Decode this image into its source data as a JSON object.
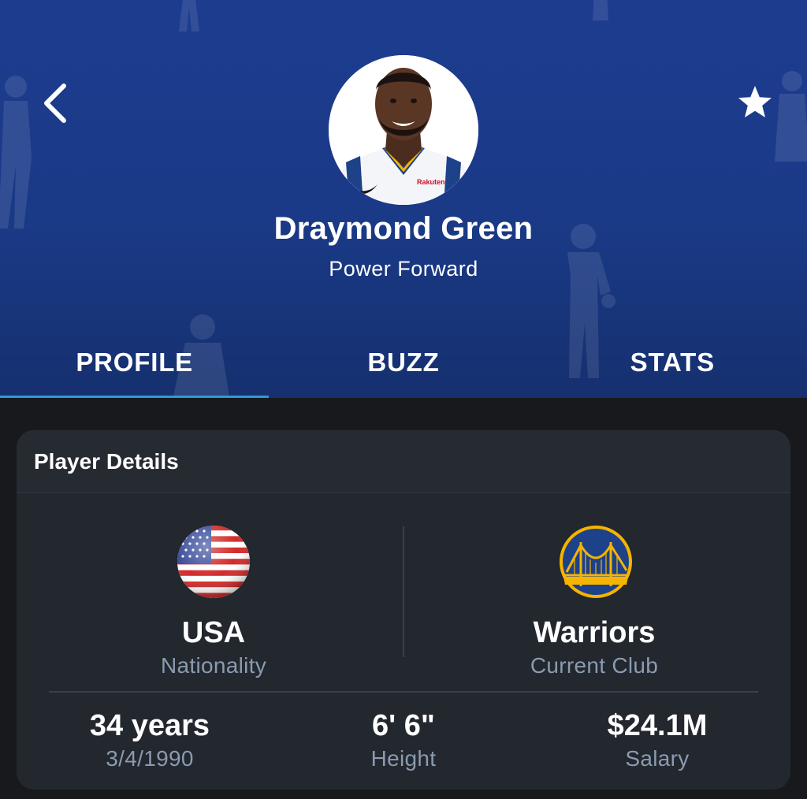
{
  "header": {
    "player_name": "Draymond Green",
    "position": "Power Forward",
    "icons": {
      "back": "chevron-left-icon",
      "favorite": "star-icon"
    }
  },
  "tabs": [
    {
      "label": "PROFILE",
      "active": true
    },
    {
      "label": "BUZZ",
      "active": false
    },
    {
      "label": "STATS",
      "active": false
    }
  ],
  "card": {
    "title": "Player Details",
    "nationality": {
      "value": "USA",
      "label": "Nationality",
      "icon": "usa-flag-icon"
    },
    "club": {
      "value": "Warriors",
      "label": "Current Club",
      "icon": "warriors-logo-icon"
    },
    "age": {
      "value": "34 years",
      "label": "3/4/1990"
    },
    "height": {
      "value": "6' 6\"",
      "label": "Height"
    },
    "salary": {
      "value": "$24.1M",
      "label": "Salary"
    }
  },
  "colors": {
    "header_blue": "#1d3c8f",
    "tab_accent": "#2e9ad8",
    "card_bg": "#23272e",
    "label_gray": "#8a9bb0"
  }
}
